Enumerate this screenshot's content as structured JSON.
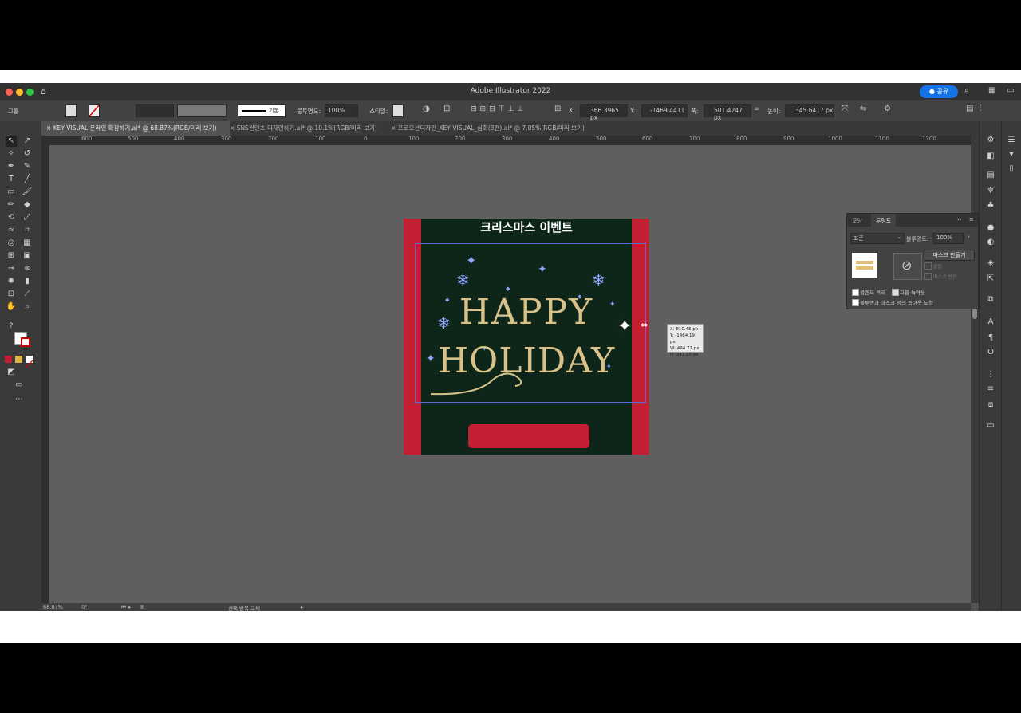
{
  "window": {
    "title": "Adobe Illustrator 2022",
    "share_label": "공유"
  },
  "control_bar": {
    "selection_type": "그룹",
    "stroke_style": "기본",
    "opacity_label": "불투명도:",
    "opacity_value": "100%",
    "style_label": "스타일:",
    "x_label": "X:",
    "x_value": "366.3965 px",
    "y_label": "Y:",
    "y_value": "-1469.4411",
    "w_label": "폭:",
    "w_value": "501.4247 px",
    "h_label": "높이:",
    "h_value": "345.6417 px"
  },
  "tabs": [
    {
      "label": "KEY VISUAL 온라인 확장하기.ai* @ 68.87%(RGB/미리 보기)",
      "close": "×"
    },
    {
      "label": "SNS컨텐츠 디자인하기.ai* @ 10.1%(RGB/미리 보기)",
      "close": "×"
    },
    {
      "label": "프로모션디자인_KEY VISUAL_심화(3편).ai* @ 7.05%(RGB/미리 보기)",
      "close": "×"
    }
  ],
  "ruler_labels": [
    "600",
    "500",
    "400",
    "300",
    "200",
    "100",
    "0",
    "100",
    "200",
    "300",
    "400",
    "500",
    "600",
    "700",
    "800",
    "900",
    "1000",
    "1100",
    "1200"
  ],
  "artboard": {
    "heading": "크리스마스 이벤트",
    "line1": "HAPPY",
    "line2": "HOLIDAY",
    "colors": {
      "background": "#0d2619",
      "red": "#c41e32",
      "gold": "#d8c28a",
      "accent": "#6e8cff"
    }
  },
  "tooltip": {
    "lines": [
      "X: 810.45 px",
      "Y: -1464.19 px",
      "W: 494.77 px",
      "H: 341.05 px"
    ]
  },
  "transparency_panel": {
    "tab_appearance": "모양",
    "tab_transparency": "투명도",
    "blend_mode": "표준",
    "opacity_label": "불투명도:",
    "opacity_value": "100%",
    "make_mask": "마스크 만들기",
    "clip": "클립",
    "invert_mask": "마스크 반전",
    "isolate_blending": "블렌드 격리",
    "knockout_group": "그룹 녹아웃",
    "opacity_mask_define": "불투명과 마스크 정의 녹아웃 도형"
  },
  "status_bar": {
    "zoom": "68.87%",
    "rotation": "0°",
    "artboard_num": "8",
    "status_text": "선택 반복 교체"
  }
}
